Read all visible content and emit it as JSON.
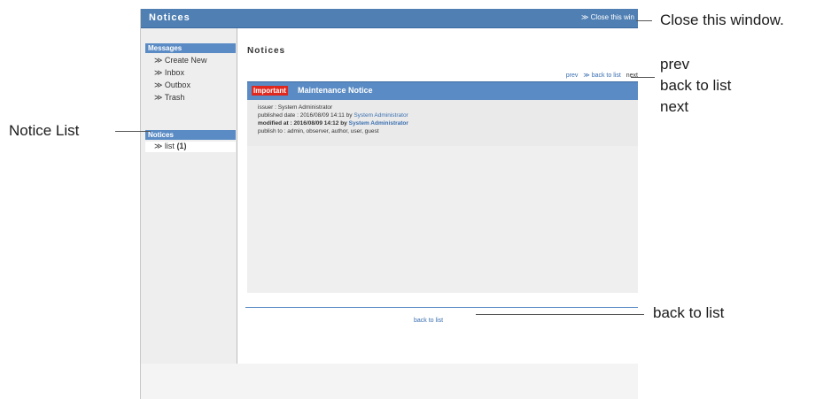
{
  "window": {
    "title": "Notices",
    "close_link": "≫ Close this win"
  },
  "sidebar": {
    "messages_header": "Messages",
    "items": [
      {
        "label": "≫ Create New"
      },
      {
        "label": "≫ Inbox"
      },
      {
        "label": "≫ Outbox"
      },
      {
        "label": "≫ Trash"
      }
    ],
    "notices_header": "Notices",
    "list_item": {
      "label": "≫ list ",
      "count": "(1)"
    }
  },
  "main": {
    "title": "Notices",
    "nav": {
      "prev": "prev",
      "back": "≫ back to list",
      "next": "next"
    },
    "notice": {
      "badge": "Important",
      "title": "Maintenance Notice",
      "issuer": "issuer : System Administrator",
      "published_prefix": "published date : 2016/08/09 14:11 by ",
      "published_by": "System Administrator",
      "modified_prefix": "modified at : 2016/08/09 14:12 by ",
      "modified_by": "System Administrator",
      "publish_to": "publish to : admin, observer, author, user, guest"
    },
    "back_to_list": "back to list"
  },
  "callouts": {
    "close": "Close this window.",
    "prev": "prev",
    "back": "back to list",
    "next": "next",
    "notice_list": "Notice List",
    "back_bottom": "back  to  list"
  }
}
